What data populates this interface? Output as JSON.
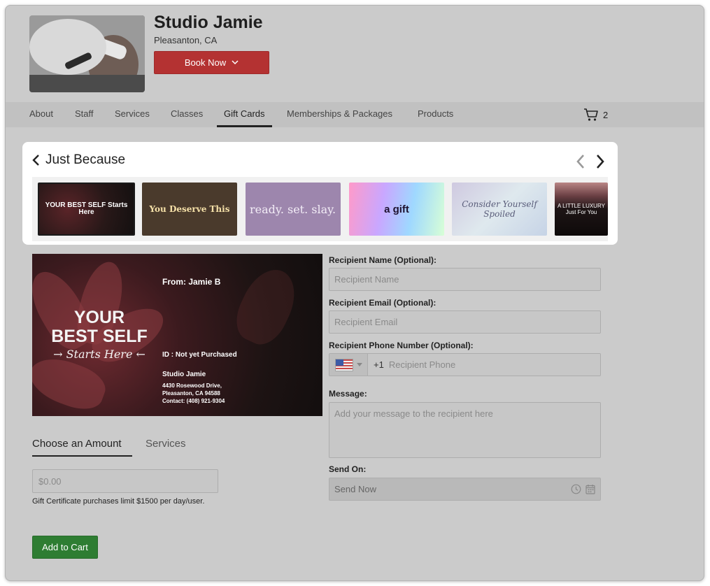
{
  "studio": {
    "name": "Studio Jamie",
    "location": "Pleasanton, CA",
    "book_now_label": "Book Now"
  },
  "nav": {
    "tabs": [
      {
        "label": "About"
      },
      {
        "label": "Staff"
      },
      {
        "label": "Services"
      },
      {
        "label": "Classes"
      },
      {
        "label": "Gift Cards"
      },
      {
        "label": "Memberships & Packages"
      },
      {
        "label": "Products"
      }
    ],
    "active": "Gift Cards",
    "cart_count": "2"
  },
  "carousel": {
    "title": "Just Because",
    "cards": [
      {
        "text": "YOUR BEST SELF Starts Here"
      },
      {
        "text": "You Deserve This"
      },
      {
        "text": "ready. set. slay."
      },
      {
        "text": "a gift"
      },
      {
        "text": "Consider Yourself Spoiled"
      },
      {
        "text": "A LITTLE LUXURY Just For You"
      }
    ]
  },
  "card_preview": {
    "line1": "YOUR",
    "line2": "BEST SELF",
    "line3": "→ Starts Here ←",
    "from": "From: Jamie B",
    "id": "ID : Not yet Purchased",
    "studio": "Studio Jamie",
    "address1": "4430 Rosewood Drive,",
    "address2": "Pleasanton, CA 94588",
    "contact": "Contact: (408) 921-9304"
  },
  "amount": {
    "tab_amount": "Choose an Amount",
    "tab_services": "Services",
    "placeholder": "$0.00",
    "limit_note": "Gift Certificate purchases limit $1500 per day/user.",
    "add_to_cart": "Add to Cart"
  },
  "form": {
    "recipient_name_label": "Recipient Name (Optional):",
    "recipient_name_placeholder": "Recipient Name",
    "recipient_email_label": "Recipient Email (Optional):",
    "recipient_email_placeholder": "Recipient Email",
    "recipient_phone_label": "Recipient Phone Number (Optional):",
    "phone_prefix": "+1",
    "recipient_phone_placeholder": "Recipient Phone",
    "message_label": "Message:",
    "message_placeholder": "Add your message to the recipient here",
    "send_on_label": "Send On:",
    "send_on_value": "Send Now"
  },
  "colors": {
    "book_now": "#b43232",
    "add_to_cart": "#2e7d32",
    "page_overlay": "#cbcbcb"
  }
}
